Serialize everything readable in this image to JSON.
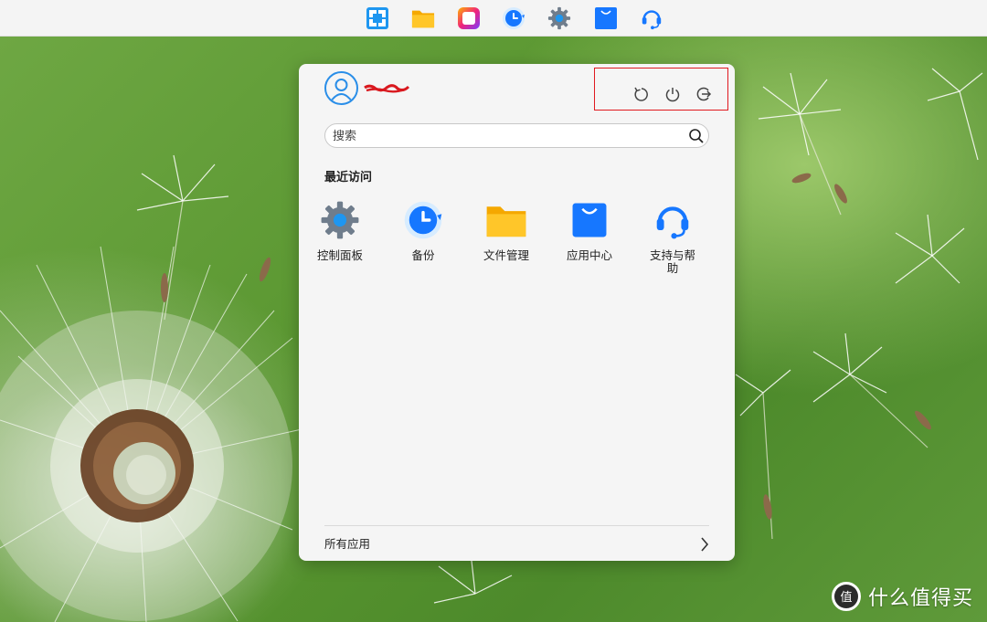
{
  "taskbar": {
    "apps": [
      {
        "name": "layout-app",
        "icon": "window-grid-icon"
      },
      {
        "name": "file-manager",
        "icon": "folder-icon"
      },
      {
        "name": "photo-app",
        "icon": "rounded-square-gradient-icon"
      },
      {
        "name": "backup",
        "icon": "clock-backup-icon"
      },
      {
        "name": "control-panel",
        "icon": "gear-icon"
      },
      {
        "name": "app-center",
        "icon": "shopping-bag-icon"
      },
      {
        "name": "support",
        "icon": "headset-icon"
      }
    ]
  },
  "start_menu": {
    "user": {
      "avatar_icon": "user-avatar-icon"
    },
    "power_actions": [
      {
        "name": "restart",
        "icon": "restart-icon"
      },
      {
        "name": "shutdown",
        "icon": "power-icon"
      },
      {
        "name": "logout",
        "icon": "logout-icon"
      }
    ],
    "search": {
      "placeholder": "搜索"
    },
    "recent_title": "最近访问",
    "recent_apps": [
      {
        "label": "控制面板",
        "icon": "gear-icon"
      },
      {
        "label": "备份",
        "icon": "clock-backup-icon"
      },
      {
        "label": "文件管理",
        "icon": "folder-icon"
      },
      {
        "label": "应用中心",
        "icon": "shopping-bag-icon"
      },
      {
        "label": "支持与帮助",
        "icon": "headset-icon"
      }
    ],
    "all_apps_label": "所有应用"
  },
  "watermark": {
    "text": "什么值得买",
    "badge_char": "值"
  },
  "colors": {
    "accent_blue": "#1677ff",
    "highlight_red": "#e0191f",
    "folder_yellow": "#ffc629",
    "panel_bg": "#f5f5f5"
  }
}
